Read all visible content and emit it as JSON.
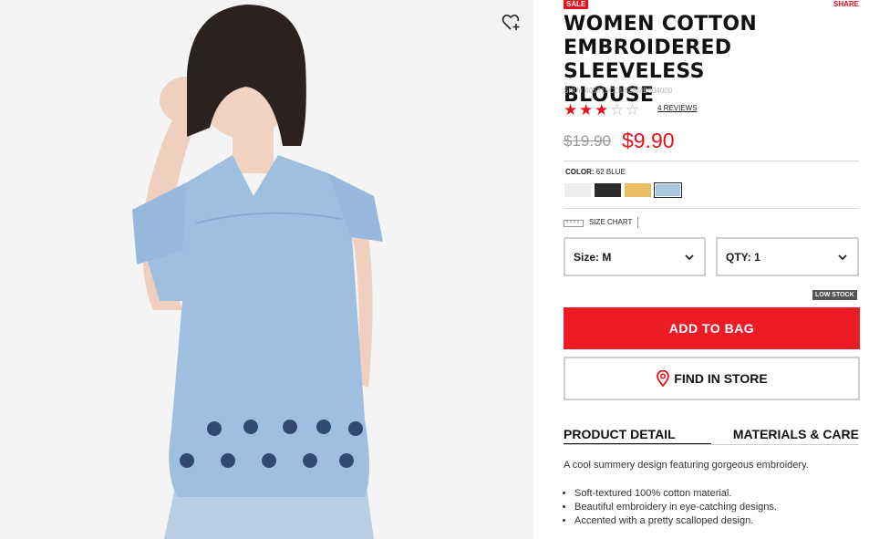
{
  "badge": "SALE",
  "share": "SHARE",
  "product": {
    "title_lines": [
      "WOMEN COTTON",
      "EMBROIDERED SLEEVELESS",
      "BLOUSE"
    ],
    "sku": "SKU# 405315COL62SMB004000",
    "rating": {
      "value": 3,
      "max": 5
    },
    "reviews": "4 REVIEWS",
    "old_price": "$19.90",
    "price": "$9.90"
  },
  "color": {
    "label": "COLOR:",
    "value": "62 BLUE",
    "swatches": [
      {
        "name": "white",
        "hex": "#eeeeee"
      },
      {
        "name": "black",
        "hex": "#2c2c2c"
      },
      {
        "name": "yellow",
        "hex": "#e9bd62"
      },
      {
        "name": "blue",
        "hex": "#a8c4de",
        "selected": true
      }
    ]
  },
  "size_chart": "SIZE CHART",
  "size_select": {
    "label": "Size:",
    "value": "M"
  },
  "qty_select": {
    "label": "QTY:",
    "value": "1"
  },
  "low_stock": "LOW STOCK",
  "add_to_bag": "ADD TO BAG",
  "find_in_store": "FIND IN STORE",
  "tabs": [
    "PRODUCT DETAIL",
    "MATERIALS & CARE"
  ],
  "description": "A cool summery design featuring gorgeous embroidery.",
  "features": [
    "Soft-textured 100% cotton material.",
    "Beautiful embroidery in eye-catching designs.",
    "Accented with a pretty scalloped design."
  ],
  "colors": {
    "accent": "#e8101b",
    "button": "#ed1c24"
  }
}
